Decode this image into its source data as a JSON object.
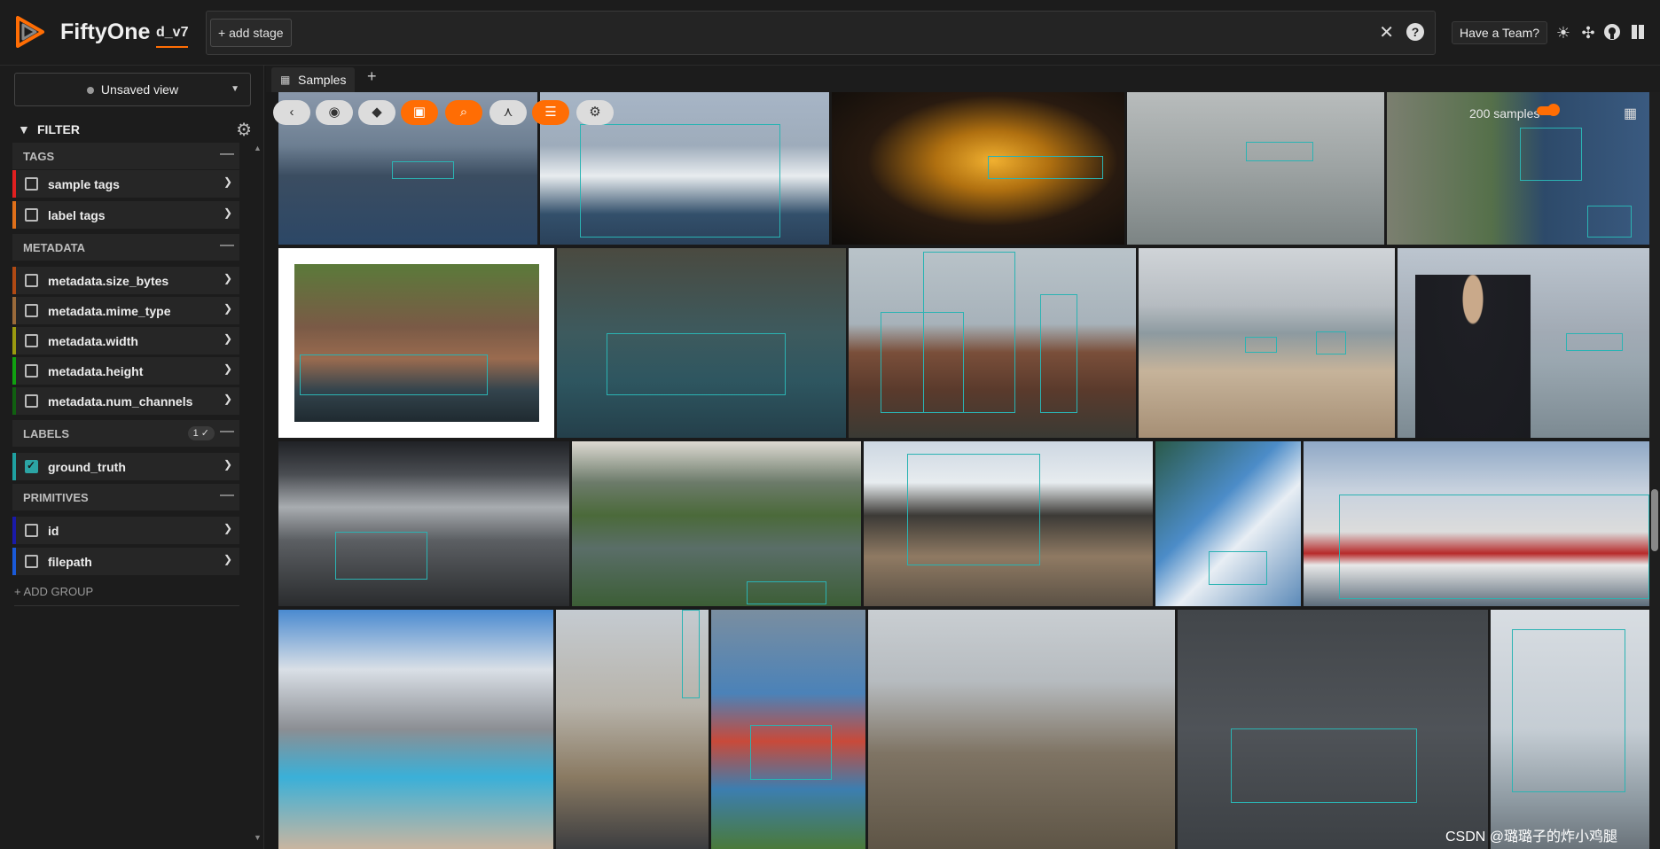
{
  "app": {
    "brand": "FiftyOne",
    "dataset": "d_v7",
    "add_stage": "+ add stage",
    "team_button": "Have a Team?",
    "icons": [
      "sun-icon",
      "slack-icon",
      "github-icon",
      "book-icon"
    ]
  },
  "sidebar": {
    "view_select": "Unsaved view",
    "filter_title": "FILTER",
    "groups": [
      {
        "name": "TAGS",
        "fields": [
          "sample tags",
          "label tags"
        ]
      },
      {
        "name": "METADATA",
        "fields": [
          "metadata.size_bytes",
          "metadata.mime_type",
          "metadata.width",
          "metadata.height",
          "metadata.num_channels"
        ]
      },
      {
        "name": "LABELS",
        "badge": "1 ✓",
        "fields": [
          "ground_truth"
        ]
      },
      {
        "name": "PRIMITIVES",
        "fields": [
          "id",
          "filepath"
        ]
      }
    ],
    "add_group": "+ ADD GROUP"
  },
  "tabs": {
    "samples": "Samples"
  },
  "grid": {
    "count": "200 samples",
    "toolbar_icons": [
      "back-icon",
      "palette-icon",
      "tag-icon",
      "patches-icon",
      "search-icon",
      "similarity-icon",
      "list-icon",
      "settings-icon"
    ]
  },
  "watermark": "CSDN @璐璐子的炸小鸡腿"
}
